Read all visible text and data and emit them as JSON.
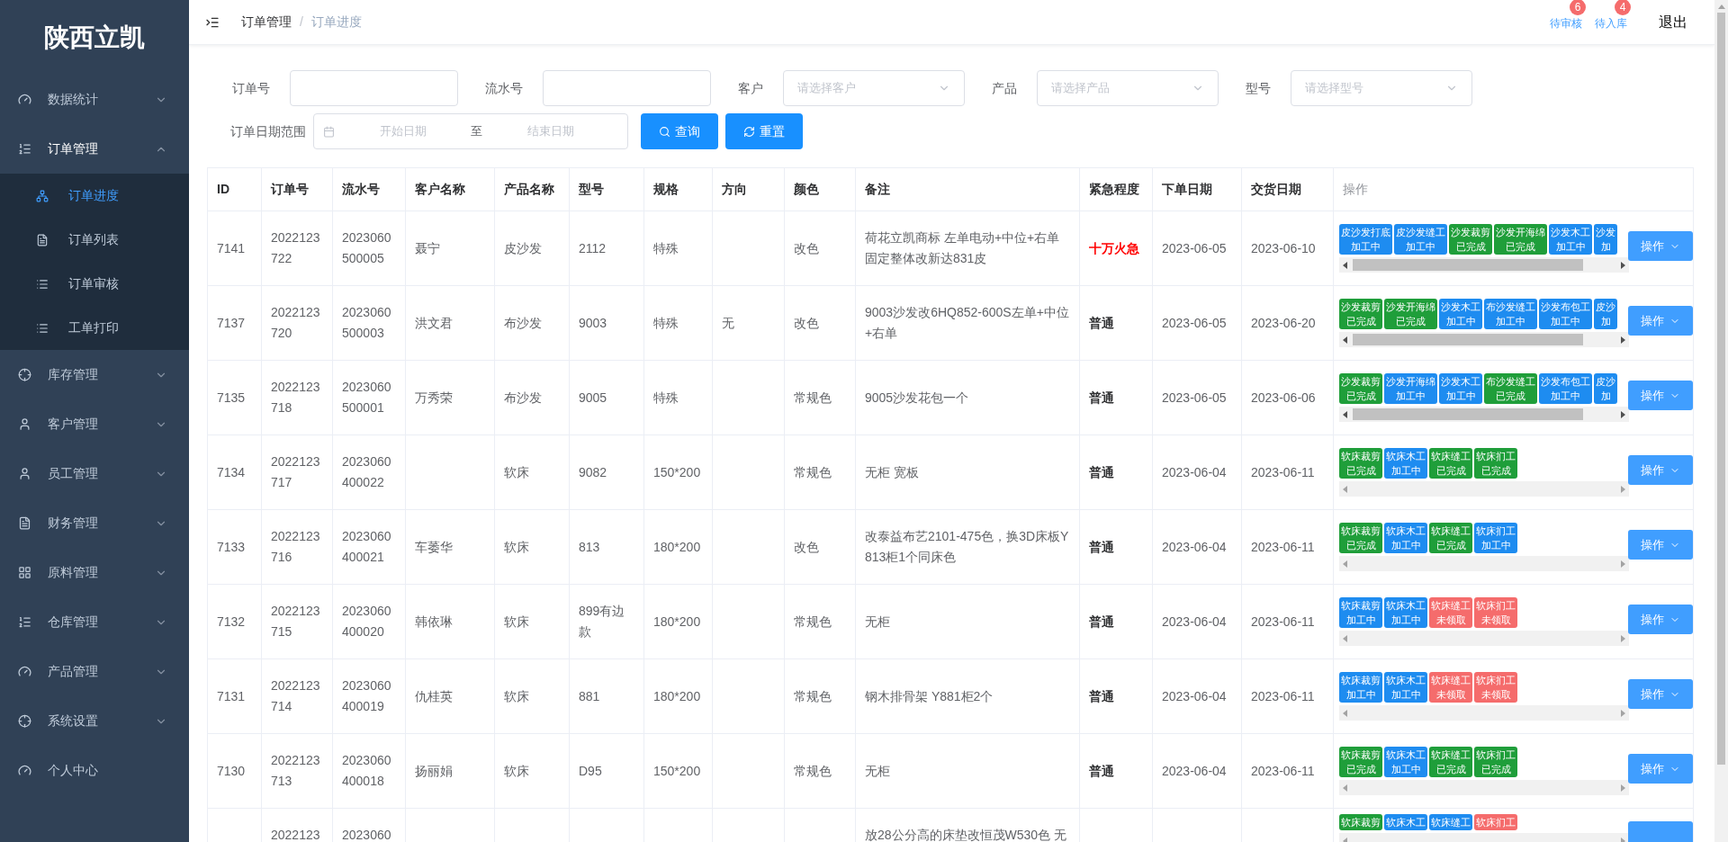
{
  "sidebar": {
    "logo": "陕西立凯",
    "items": [
      {
        "label": "数据统计",
        "expanded": false,
        "has_children": true
      },
      {
        "label": "订单管理",
        "expanded": true,
        "has_children": true,
        "children": [
          {
            "label": "订单进度",
            "selected": true
          },
          {
            "label": "订单列表",
            "selected": false
          },
          {
            "label": "订单审核",
            "selected": false
          },
          {
            "label": "工单打印",
            "selected": false
          }
        ]
      },
      {
        "label": "库存管理",
        "expanded": false,
        "has_children": true
      },
      {
        "label": "客户管理",
        "expanded": false,
        "has_children": true
      },
      {
        "label": "员工管理",
        "expanded": false,
        "has_children": true
      },
      {
        "label": "财务管理",
        "expanded": false,
        "has_children": true
      },
      {
        "label": "原料管理",
        "expanded": false,
        "has_children": true
      },
      {
        "label": "仓库管理",
        "expanded": false,
        "has_children": true
      },
      {
        "label": "产品管理",
        "expanded": false,
        "has_children": true
      },
      {
        "label": "系统设置",
        "expanded": false,
        "has_children": true
      },
      {
        "label": "个人中心",
        "expanded": false,
        "has_children": false
      }
    ]
  },
  "header": {
    "breadcrumb": [
      "订单管理",
      "订单进度"
    ],
    "separator": "/",
    "links": [
      {
        "label": "待审核",
        "badge": "6"
      },
      {
        "label": "待入库",
        "badge": "4"
      }
    ],
    "logout": "退出"
  },
  "filters": {
    "fields": [
      {
        "kind": "input",
        "label": "订单号"
      },
      {
        "kind": "input",
        "label": "流水号"
      },
      {
        "kind": "select",
        "label": "客户",
        "placeholder": "请选择客户"
      },
      {
        "kind": "select",
        "label": "产品",
        "placeholder": "请选择产品"
      },
      {
        "kind": "select",
        "label": "型号",
        "placeholder": "请选择型号"
      }
    ],
    "date_range": {
      "label": "订单日期范围",
      "start_placeholder": "开始日期",
      "separator": "至",
      "end_placeholder": "结束日期"
    },
    "buttons": [
      {
        "kind": "search",
        "label": "查询"
      },
      {
        "kind": "reset",
        "label": "重置"
      }
    ]
  },
  "table": {
    "columns": [
      "ID",
      "订单号",
      "流水号",
      "客户名称",
      "产品名称",
      "型号",
      "规格",
      "方向",
      "颜色",
      "备注",
      "紧急程度",
      "下单日期",
      "交货日期",
      "操作"
    ],
    "rows": [
      {
        "id": "7141",
        "order_no": "2022123722",
        "serial_no": "2023060500005",
        "customer": "聂宁",
        "product": "皮沙发",
        "model": "2112",
        "spec": "特殊",
        "finish": "改色",
        "note": "荷花立凯商标 左单电动+中位+右单固定整体改新达831皮",
        "urgency": {
          "text": "十万火急",
          "urgent": true
        },
        "order_date": "2023-06-05",
        "delivery_date": "2023-06-10",
        "action": "操作",
        "stages": [
          {
            "name": "皮沙发打底",
            "status": "加工中",
            "kind": "processing"
          },
          {
            "name": "皮沙发缝工",
            "status": "加工中",
            "kind": "processing"
          },
          {
            "name": "沙发裁剪",
            "status": "已完成",
            "kind": "done"
          },
          {
            "name": "沙发开海绵",
            "status": "已完成",
            "kind": "done"
          },
          {
            "name": "沙发木工",
            "status": "加工中",
            "kind": "processing"
          },
          {
            "name": "沙发",
            "status": "加",
            "kind": "processing"
          }
        ]
      },
      {
        "id": "7137",
        "order_no": "2022123720",
        "serial_no": "2023060500003",
        "customer": "洪文君",
        "product": "布沙发",
        "model": "9003",
        "spec": "特殊",
        "direction": "无",
        "finish": "改色",
        "note": "9003沙发改6HQ852-600S左单+中位+右单",
        "urgency": {
          "text": "普通",
          "urgent": false
        },
        "order_date": "2023-06-05",
        "delivery_date": "2023-06-20",
        "action": "操作",
        "stages": [
          {
            "name": "沙发裁剪",
            "status": "已完成",
            "kind": "done"
          },
          {
            "name": "沙发开海绵",
            "status": "已完成",
            "kind": "done"
          },
          {
            "name": "沙发木工",
            "status": "加工中",
            "kind": "processing"
          },
          {
            "name": "布沙发缝工",
            "status": "加工中",
            "kind": "processing"
          },
          {
            "name": "沙发布包工",
            "status": "加工中",
            "kind": "processing"
          },
          {
            "name": "皮沙",
            "status": "加",
            "kind": "processing"
          }
        ]
      },
      {
        "id": "7135",
        "order_no": "2022123718",
        "serial_no": "2023060500001",
        "customer": "万秀荣",
        "product": "布沙发",
        "model": "9005",
        "spec": "特殊",
        "finish": "常规色",
        "note": "9005沙发花包一个",
        "urgency": {
          "text": "普通",
          "urgent": false
        },
        "order_date": "2023-06-05",
        "delivery_date": "2023-06-06",
        "action": "操作",
        "stages": [
          {
            "name": "沙发裁剪",
            "status": "已完成",
            "kind": "done"
          },
          {
            "name": "沙发开海绵",
            "status": "加工中",
            "kind": "processing"
          },
          {
            "name": "沙发木工",
            "status": "加工中",
            "kind": "processing"
          },
          {
            "name": "布沙发缝工",
            "status": "已完成",
            "kind": "done"
          },
          {
            "name": "沙发布包工",
            "status": "加工中",
            "kind": "processing"
          },
          {
            "name": "皮沙",
            "status": "加",
            "kind": "processing"
          }
        ]
      },
      {
        "id": "7134",
        "order_no": "2022123717",
        "serial_no": "2023060400022",
        "product": "软床",
        "model": "9082",
        "spec": "150*200",
        "finish": "常规色",
        "note": "无柜 宽板",
        "urgency": {
          "text": "普通",
          "urgent": false
        },
        "order_date": "2023-06-04",
        "delivery_date": "2023-06-11",
        "action": "操作",
        "stages": [
          {
            "name": "软床裁剪",
            "status": "已完成",
            "kind": "done"
          },
          {
            "name": "软床木工",
            "status": "加工中",
            "kind": "processing"
          },
          {
            "name": "软床缝工",
            "status": "已完成",
            "kind": "done"
          },
          {
            "name": "软床扪工",
            "status": "已完成",
            "kind": "done"
          }
        ]
      },
      {
        "id": "7133",
        "order_no": "2022123716",
        "serial_no": "2023060400021",
        "customer": "车萎华",
        "product": "软床",
        "model": "813",
        "spec": "180*200",
        "finish": "改色",
        "note": "改泰益布艺2101-475色，换3D床板Y813柜1个同床色",
        "urgency": {
          "text": "普通",
          "urgent": false
        },
        "order_date": "2023-06-04",
        "delivery_date": "2023-06-11",
        "action": "操作",
        "stages": [
          {
            "name": "软床裁剪",
            "status": "已完成",
            "kind": "done"
          },
          {
            "name": "软床木工",
            "status": "加工中",
            "kind": "processing"
          },
          {
            "name": "软床缝工",
            "status": "已完成",
            "kind": "done"
          },
          {
            "name": "软床扪工",
            "status": "加工中",
            "kind": "processing"
          }
        ]
      },
      {
        "id": "7132",
        "order_no": "2022123715",
        "serial_no": "2023060400020",
        "customer": "韩依琳",
        "product": "软床",
        "model": "899有边款",
        "spec": "180*200",
        "finish": "常规色",
        "note": "无柜",
        "urgency": {
          "text": "普通",
          "urgent": false
        },
        "order_date": "2023-06-04",
        "delivery_date": "2023-06-11",
        "action": "操作",
        "stages": [
          {
            "name": "软床裁剪",
            "status": "加工中",
            "kind": "processing"
          },
          {
            "name": "软床木工",
            "status": "加工中",
            "kind": "processing"
          },
          {
            "name": "软床缝工",
            "status": "未领取",
            "kind": "unclaimed"
          },
          {
            "name": "软床扪工",
            "status": "未领取",
            "kind": "unclaimed"
          }
        ]
      },
      {
        "id": "7131",
        "order_no": "2022123714",
        "serial_no": "2023060400019",
        "customer": "仇桂英",
        "product": "软床",
        "model": "881",
        "spec": "180*200",
        "finish": "常规色",
        "note": "钢木排骨架 Y881柜2个",
        "urgency": {
          "text": "普通",
          "urgent": false
        },
        "order_date": "2023-06-04",
        "delivery_date": "2023-06-11",
        "action": "操作",
        "stages": [
          {
            "name": "软床裁剪",
            "status": "加工中",
            "kind": "processing"
          },
          {
            "name": "软床木工",
            "status": "加工中",
            "kind": "processing"
          },
          {
            "name": "软床缝工",
            "status": "未领取",
            "kind": "unclaimed"
          },
          {
            "name": "软床扪工",
            "status": "未领取",
            "kind": "unclaimed"
          }
        ]
      },
      {
        "id": "7130",
        "order_no": "2022123713",
        "serial_no": "2023060400018",
        "customer": "扬丽娟",
        "product": "软床",
        "model": "D95",
        "spec": "150*200",
        "finish": "常规色",
        "note": "无柜",
        "urgency": {
          "text": "普通",
          "urgent": false
        },
        "order_date": "2023-06-04",
        "delivery_date": "2023-06-11",
        "action": "操作",
        "stages": [
          {
            "name": "软床裁剪",
            "status": "已完成",
            "kind": "done"
          },
          {
            "name": "软床木工",
            "status": "加工中",
            "kind": "processing"
          },
          {
            "name": "软床缝工",
            "status": "已完成",
            "kind": "done"
          },
          {
            "name": "软床扪工",
            "status": "已完成",
            "kind": "done"
          }
        ]
      },
      {
        "order_no": "2022123",
        "serial_no": "2023060",
        "note": "放28公分高的床垫改恒茂W530色 无",
        "stages": [
          {
            "name": "软床裁剪",
            "kind": "done"
          },
          {
            "name": "软床木工",
            "kind": "processing"
          },
          {
            "name": "软床缝工",
            "kind": "processing"
          },
          {
            "name": "软床扪工",
            "kind": "unclaimed"
          }
        ]
      }
    ]
  }
}
